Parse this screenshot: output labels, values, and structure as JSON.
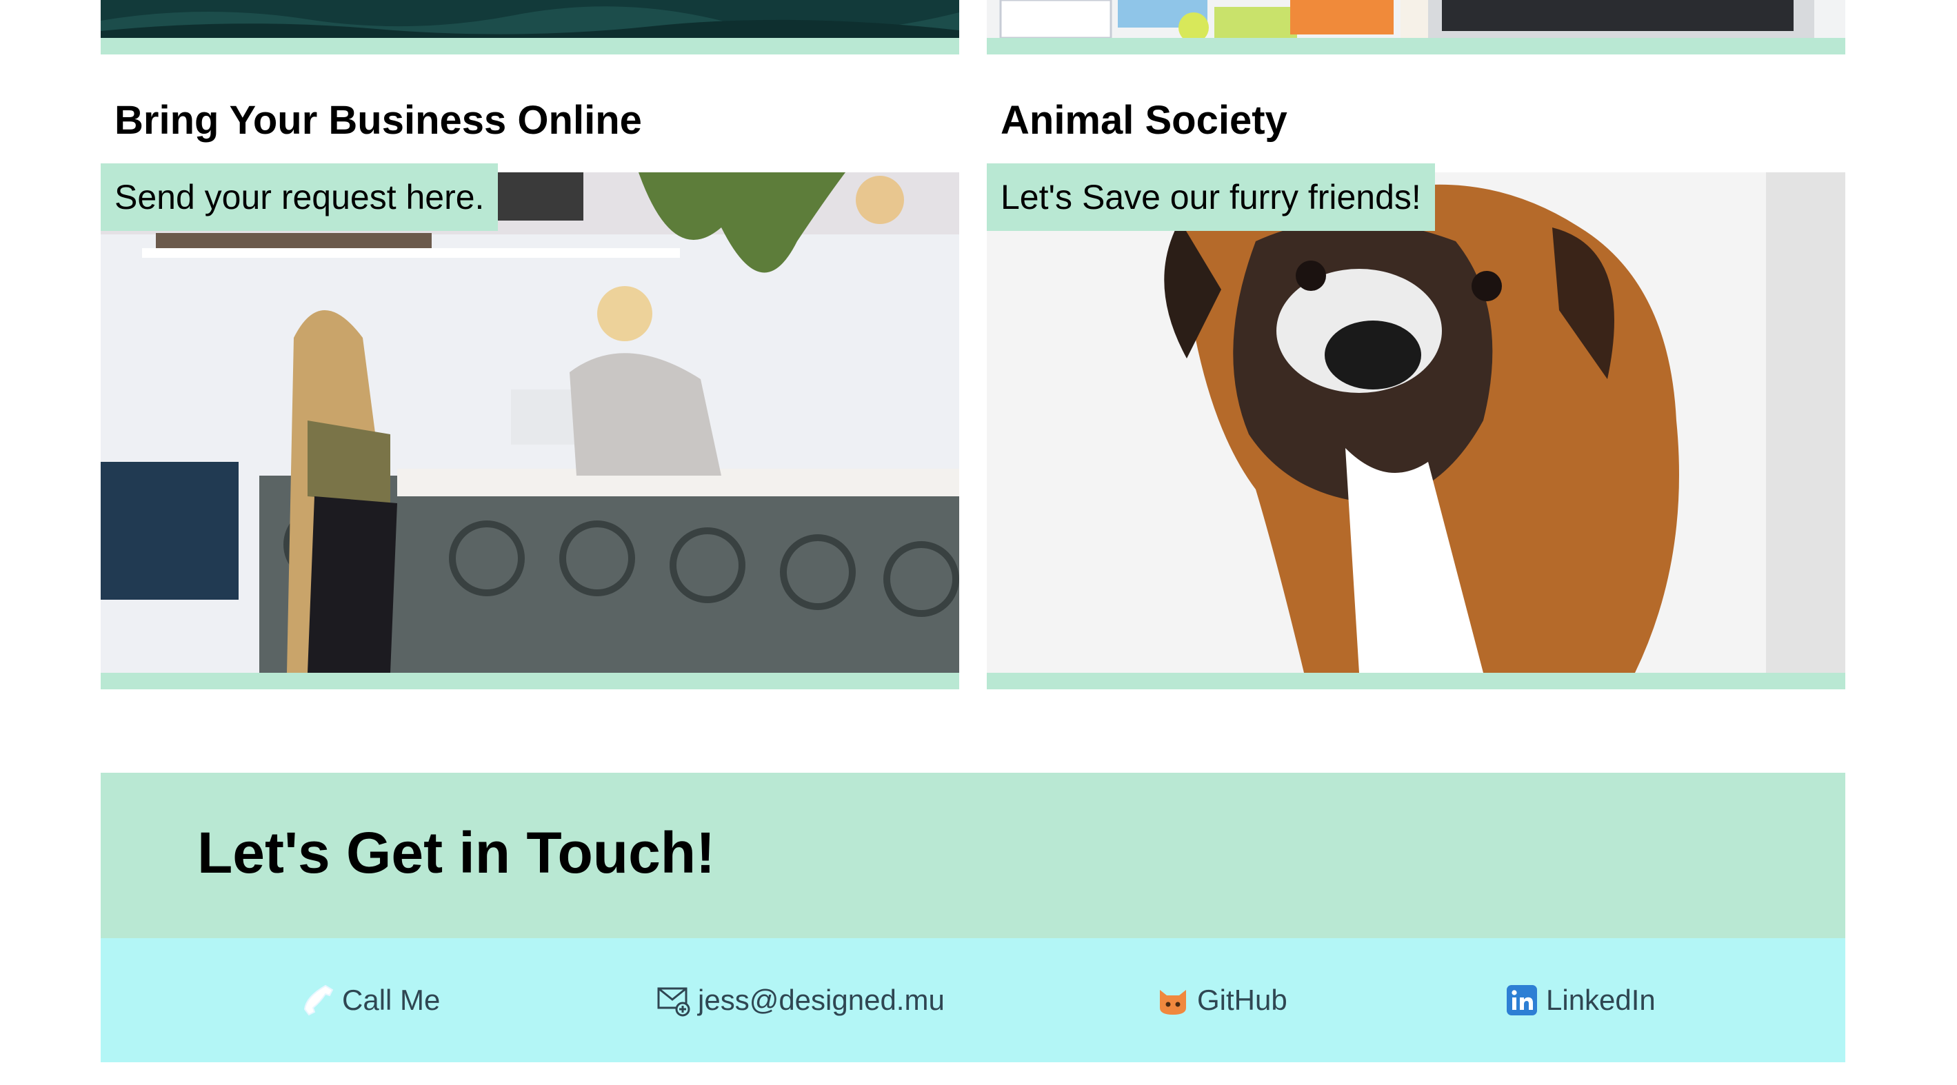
{
  "cards": [
    {
      "title": "Bring Your Business Online",
      "caption": "Send your request here.",
      "image": "reception-counter-photo"
    },
    {
      "title": "Animal Society",
      "caption": "Let's Save our furry friends!",
      "image": "boxer-dog-photo"
    }
  ],
  "contact": {
    "title": "Let's Get in Touch!",
    "links": [
      {
        "label": "Call Me",
        "icon": "phone-icon"
      },
      {
        "label": "jess@designed.mu",
        "icon": "mail-icon"
      },
      {
        "label": "GitHub",
        "icon": "github-icon"
      },
      {
        "label": "LinkedIn",
        "icon": "linkedin-icon"
      }
    ]
  },
  "colors": {
    "accent_mint": "#b9e8d3",
    "contact_bar": "#b3f6f6",
    "link_text": "#2f4652"
  }
}
